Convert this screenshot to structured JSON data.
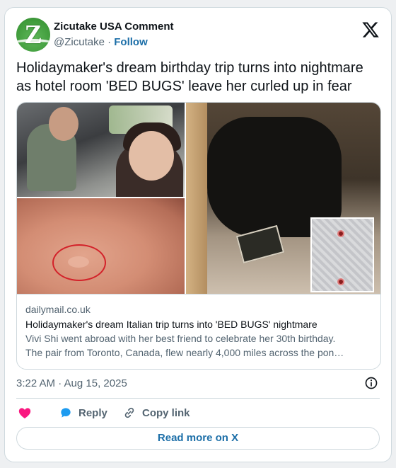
{
  "author": {
    "name": "Zicutake USA Comment",
    "handle": "@Zicutake",
    "separator": "·",
    "follow_label": "Follow",
    "avatar_letter": "Z"
  },
  "tweet": {
    "text": "Holidaymaker's dream birthday trip turns into nightmare as hotel room 'BED BUGS' leave her curled up in fear"
  },
  "link_card": {
    "domain": "dailymail.co.uk",
    "title": "Holidaymaker's dream Italian trip turns into 'BED BUGS' nightmare",
    "description_line1": "Vivi Shi went abroad with her best friend to celebrate her 30th birthday.",
    "description_line2": "The pair from Toronto, Canada, flew nearly 4,000 miles across the pon…"
  },
  "meta": {
    "timestamp": "3:22 AM · Aug 15, 2025"
  },
  "actions": {
    "reply_label": "Reply",
    "copy_label": "Copy link"
  },
  "read_more_label": "Read more on X",
  "colors": {
    "accent": "#1d6fa8",
    "like": "#f91880",
    "reply_icon": "#1d9bf0",
    "border": "#cfd9de",
    "muted_text": "#536471"
  },
  "icons": [
    "x-logo-icon",
    "heart-icon",
    "reply-bubble-icon",
    "link-icon",
    "info-icon"
  ]
}
